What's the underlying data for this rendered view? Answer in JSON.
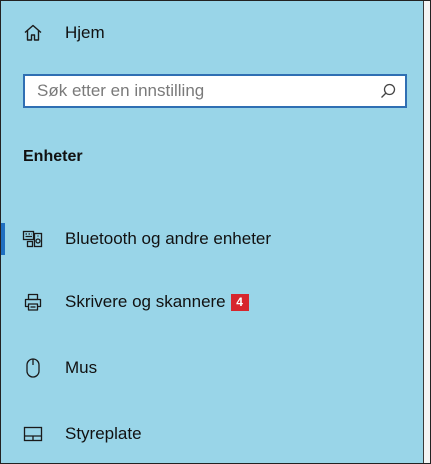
{
  "nav": {
    "home": {
      "label": "Hjem",
      "icon": "home-icon"
    }
  },
  "search": {
    "placeholder": "Søk etter en innstilling",
    "value": "",
    "icon": "search-icon"
  },
  "section": {
    "title": "Enheter"
  },
  "items": [
    {
      "label": "Bluetooth og andre enheter",
      "icon": "bluetooth-devices-icon",
      "selected": true
    },
    {
      "label": "Skrivere og skannere",
      "icon": "printer-icon",
      "badge": "4"
    },
    {
      "label": "Mus",
      "icon": "mouse-icon"
    },
    {
      "label": "Styreplate",
      "icon": "touchpad-icon"
    }
  ],
  "colors": {
    "panel_background": "#99d5e8",
    "search_border": "#2f6fb3",
    "selection_indicator": "#1f6fc0",
    "badge_background": "#d7262d"
  }
}
